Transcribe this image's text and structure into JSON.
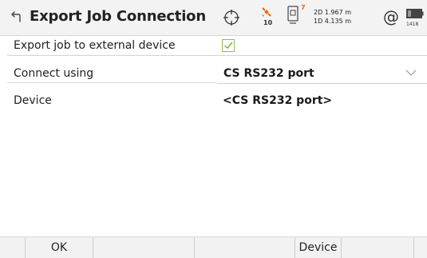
{
  "header": {
    "title": "Export Job Connection",
    "satellite_count": "10",
    "device_number": "7",
    "precision_2d": "2D 1.967 m",
    "precision_1d": "1D 4.135 m",
    "at_symbol": "@",
    "clock": "1418",
    "icons": [
      "back-arrow-icon",
      "crosshair-icon",
      "satellite-icon",
      "device-icon",
      "at-icon",
      "battery-icon"
    ]
  },
  "form": {
    "export_label": "Export job to external device",
    "export_checked": true,
    "connect_label": "Connect using",
    "connect_value": "CS RS232 port",
    "device_label": "Device",
    "device_value": "<CS RS232 port>"
  },
  "softkeys": {
    "f1": "OK",
    "f2": "",
    "f3": "",
    "f4": "Device",
    "f5": "",
    "f6": ""
  },
  "colors": {
    "accent_orange": "#e06a12",
    "checkbox_green": "#7db33a"
  }
}
